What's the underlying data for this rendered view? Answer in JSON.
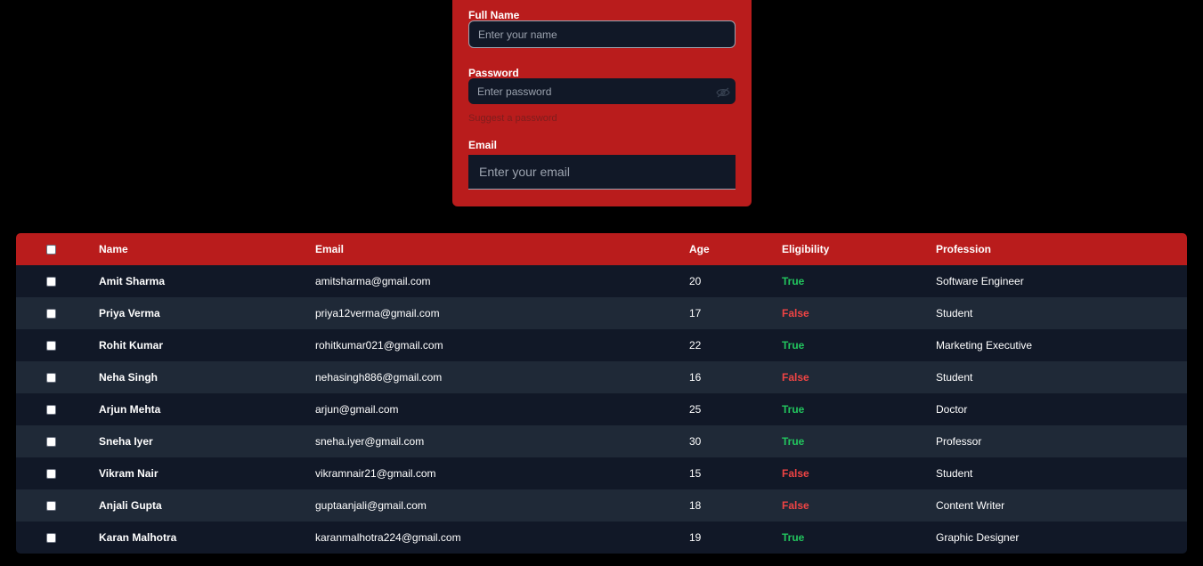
{
  "form": {
    "name_label": "Full Name",
    "name_placeholder": "Enter your name",
    "password_label": "Password",
    "password_placeholder": "Enter password",
    "suggest_text": "Suggest a password",
    "email_label": "Email",
    "email_placeholder": "Enter your email"
  },
  "table": {
    "headers": {
      "name": "Name",
      "email": "Email",
      "age": "Age",
      "eligibility": "Eligibility",
      "profession": "Profession"
    },
    "rows": [
      {
        "name": "Amit Sharma",
        "email": "amitsharma@gmail.com",
        "age": "20",
        "eligibility": "True",
        "profession": "Software Engineer"
      },
      {
        "name": "Priya Verma",
        "email": "priya12verma@gmail.com",
        "age": "17",
        "eligibility": "False",
        "profession": "Student"
      },
      {
        "name": "Rohit Kumar",
        "email": "rohitkumar021@gmail.com",
        "age": "22",
        "eligibility": "True",
        "profession": "Marketing Executive"
      },
      {
        "name": "Neha Singh",
        "email": "nehasingh886@gmail.com",
        "age": "16",
        "eligibility": "False",
        "profession": "Student"
      },
      {
        "name": "Arjun Mehta",
        "email": "arjun@gmail.com",
        "age": "25",
        "eligibility": "True",
        "profession": "Doctor"
      },
      {
        "name": "Sneha Iyer",
        "email": "sneha.iyer@gmail.com",
        "age": "30",
        "eligibility": "True",
        "profession": "Professor"
      },
      {
        "name": "Vikram Nair",
        "email": "vikramnair21@gmail.com",
        "age": "15",
        "eligibility": "False",
        "profession": "Student"
      },
      {
        "name": "Anjali Gupta",
        "email": "guptaanjali@gmail.com",
        "age": "18",
        "eligibility": "False",
        "profession": "Content Writer"
      },
      {
        "name": "Karan Malhotra",
        "email": "karanmalhotra224@gmail.com",
        "age": "19",
        "eligibility": "True",
        "profession": "Graphic Designer"
      }
    ]
  },
  "colors": {
    "accent": "#b91c1c",
    "true": "#22c55e",
    "false": "#ef4444",
    "row_dark": "#111827",
    "row_light": "#1f2937"
  },
  "icons": {
    "password_toggle": "eye-off-icon"
  }
}
